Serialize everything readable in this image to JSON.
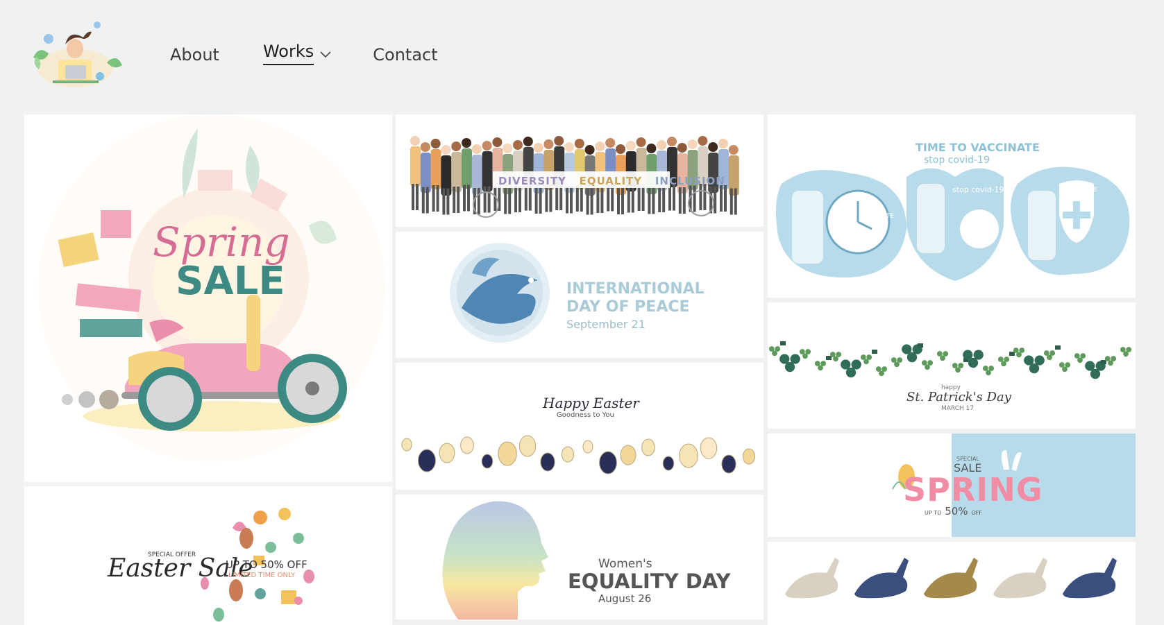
{
  "header": {
    "logo_alt": "designer illustration logo",
    "nav": [
      {
        "label": "About"
      },
      {
        "label": "Works",
        "active": true,
        "icon": "chevron-down-icon"
      },
      {
        "label": "Contact"
      }
    ]
  },
  "gallery": {
    "spring_sale": {
      "script": "Spring",
      "big": "SALE"
    },
    "easter_sale": {
      "offer": "SPECIAL OFFER",
      "script": "Easter Sale",
      "discount": "UP TO 50% OFF",
      "limited": "LIMITED TIME ONLY"
    },
    "diversity": {
      "words": [
        "DIVERSITY",
        "EQUALITY",
        "INCLUSION"
      ]
    },
    "peace": {
      "line1": "INTERNATIONAL",
      "line2": "DAY OF PEACE",
      "date": "September 21"
    },
    "easter_banner": {
      "script": "Happy Easter",
      "sub": "Goodness to You"
    },
    "womens_day": {
      "top": "Women's",
      "big": "EQUALITY DAY",
      "date": "August 26"
    },
    "vaccinate": {
      "title1": "TIME TO VACCINATE",
      "title2": "stop covid-19",
      "badge1": "TIME TO VACCINATE",
      "badge2": "stop covid-19",
      "badge3": "VACCINE"
    },
    "patricks": {
      "happy": "happy",
      "script": "St. Patrick's Day",
      "date": "MARCH 17"
    },
    "spring_special": {
      "special": "SPECIAL",
      "sale": "SALE",
      "big": "SPRING",
      "upto": "UP TO",
      "pct": "50%",
      "off": "OFF"
    }
  },
  "colors": {
    "background": "#eff2f1",
    "teal": "#3d8a83",
    "pink": "#e98fab",
    "light_blue": "#b7dbea",
    "peace_text": "#a9cbd8"
  }
}
